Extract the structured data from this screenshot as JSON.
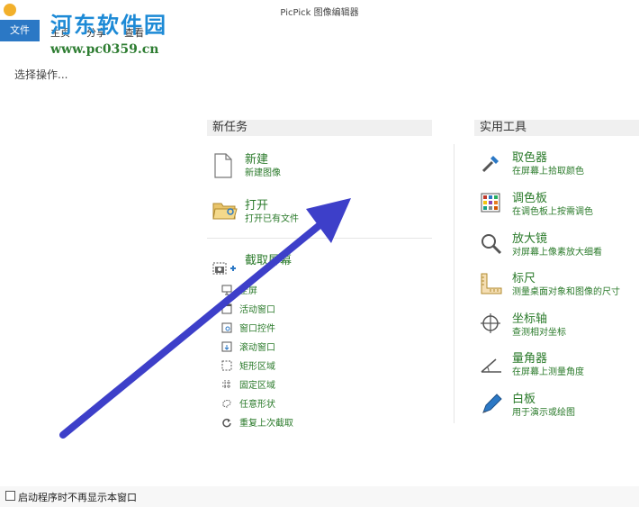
{
  "window": {
    "title": "PicPick 图像编辑器"
  },
  "watermark": {
    "title": "河东软件园",
    "url": "www.pc0359.cn"
  },
  "ribbon": {
    "file_tab": "文件",
    "tabs": [
      "主页",
      "分享",
      "查看"
    ]
  },
  "main": {
    "subtitle": "选择操作..."
  },
  "new_task": {
    "header": "新任务",
    "items": [
      {
        "title": "新建",
        "desc": "新建图像",
        "icon": "document-icon"
      },
      {
        "title": "打开",
        "desc": "打开已有文件",
        "icon": "folder-open-icon"
      }
    ],
    "capture": {
      "title": "截取屏幕",
      "icon": "camera-icon",
      "sub_items": [
        {
          "label": "全屏",
          "icon": "monitor-icon"
        },
        {
          "label": "活动窗口",
          "icon": "active-window-icon"
        },
        {
          "label": "窗口控件",
          "icon": "window-control-icon"
        },
        {
          "label": "滚动窗口",
          "icon": "scroll-window-icon"
        },
        {
          "label": "矩形区域",
          "icon": "rectangle-region-icon"
        },
        {
          "label": "固定区域",
          "icon": "fixed-region-icon"
        },
        {
          "label": "任意形状",
          "icon": "freeform-icon"
        },
        {
          "label": "重复上次截取",
          "icon": "repeat-icon"
        }
      ]
    }
  },
  "tools": {
    "header": "实用工具",
    "items": [
      {
        "title": "取色器",
        "desc": "在屏幕上拾取颜色",
        "icon": "eyedropper-icon"
      },
      {
        "title": "调色板",
        "desc": "在调色板上按需调色",
        "icon": "palette-icon"
      },
      {
        "title": "放大镜",
        "desc": "对屏幕上像素放大细看",
        "icon": "magnifier-icon"
      },
      {
        "title": "标尺",
        "desc": "测量桌面对象和图像的尺寸",
        "icon": "ruler-icon"
      },
      {
        "title": "坐标轴",
        "desc": "查测相对坐标",
        "icon": "crosshair-icon"
      },
      {
        "title": "量角器",
        "desc": "在屏幕上测量角度",
        "icon": "protractor-icon"
      },
      {
        "title": "白板",
        "desc": "用于演示或绘图",
        "icon": "pen-icon"
      }
    ]
  },
  "footer": {
    "checkbox_label": "启动程序时不再显示本窗口"
  },
  "colors": {
    "accent": "#2b78c5",
    "link": "#2a7a2a",
    "arrow": "#3d3fc9"
  }
}
